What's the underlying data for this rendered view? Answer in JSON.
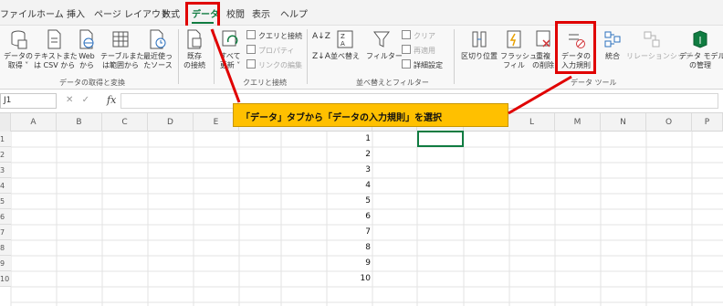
{
  "menu": {
    "tabs": [
      "ファイル",
      "ホーム",
      "挿入",
      "ページ レイアウト",
      "数式",
      "データ",
      "校閲",
      "表示",
      "ヘルプ"
    ],
    "active": "データ"
  },
  "ribbon": {
    "get_data": {
      "get_data_label_1": "データの",
      "get_data_label_2": "取得 ˅",
      "text_csv_1": "テキストまた",
      "text_csv_2": "は CSV から",
      "web_1": "Web",
      "web_2": "から",
      "table_range_1": "テーブルまた",
      "table_range_2": "は範囲から",
      "recent_1": "最近使っ",
      "recent_2": "たソース",
      "existing_1": "既存",
      "existing_2": "の接続",
      "group_label": "データの取得と変換"
    },
    "queries": {
      "refresh_1": "すべて",
      "refresh_2": "更新 ˅",
      "queries_connections": "クエリと接続",
      "properties": "プロパティ",
      "edit_links": "リンクの編集",
      "group_label": "クエリと接続"
    },
    "sort_filter": {
      "sort": "並べ替え",
      "filter": "フィルター",
      "clear": "クリア",
      "reapply": "再適用",
      "advanced": "詳細設定",
      "group_label": "並べ替えとフィルター"
    },
    "data_tools": {
      "text_to_columns": "区切り位置",
      "flash_fill_1": "フラッシュ",
      "flash_fill_2": "フィル",
      "remove_dup_1": "重複",
      "remove_dup_2": "の削除",
      "validation_1": "データの",
      "validation_2": "入力規則",
      "consolidate": "統合",
      "relationships": "リレーションシップ",
      "data_model_1": "データ モデル",
      "data_model_2": "の管理",
      "group_label": "データ ツール"
    }
  },
  "formula_bar": {
    "name_box": "J1",
    "fx": "fx",
    "cancel": "✕",
    "enter": "✓"
  },
  "callout": {
    "text": "「データ」タブから「データの入力規則」を選択"
  },
  "sheet": {
    "columns": [
      "A",
      "B",
      "C",
      "D",
      "E",
      "",
      "",
      "",
      "",
      "L",
      "M",
      "N",
      "O",
      "P"
    ],
    "rows": [
      "1",
      "2",
      "3",
      "4",
      "5",
      "6",
      "7",
      "8",
      "9",
      "10"
    ],
    "values": [
      "1",
      "2",
      "3",
      "4",
      "5",
      "6",
      "7",
      "8",
      "9",
      "10"
    ]
  },
  "colors": {
    "accent": "#107c41",
    "highlight_red": "#e00000",
    "callout_bg": "#ffc000"
  }
}
